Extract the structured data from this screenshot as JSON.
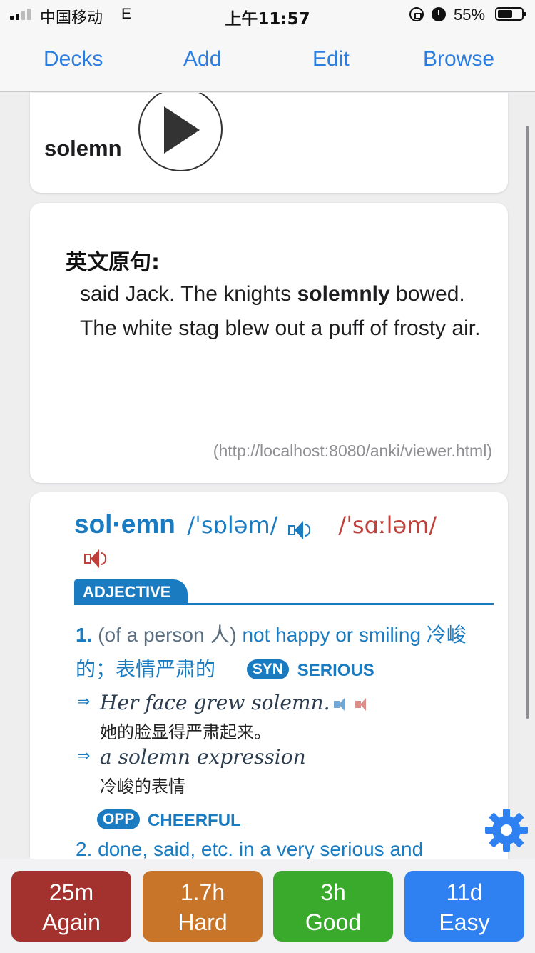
{
  "status_bar": {
    "carrier": "中国移动",
    "network": "E",
    "time": "上午11:57",
    "battery": "55%"
  },
  "nav": {
    "decks": "Decks",
    "add": "Add",
    "edit": "Edit",
    "browse": "Browse"
  },
  "front": {
    "word": "solemn"
  },
  "sentence": {
    "heading": "英文原句:",
    "before": "said Jack. The knights ",
    "highlight": "solemnly",
    "after": " bowed. The white stag blew out a puff of frosty air.",
    "source": "(http://localhost:8080/anki/viewer.html)"
  },
  "dictionary": {
    "headword": "sol·emn",
    "ipa_uk": "/ˈsɒləm/",
    "ipa_us": "/ˈsɑːləm/",
    "pos": "ADJECTIVE",
    "sense1": {
      "number": "1.",
      "gloss": "(of a person 人)",
      "definition": "not happy or smiling 冷峻的；表情严肃的",
      "syn_badge": "SYN",
      "syn_word": "SERIOUS"
    },
    "examples": [
      {
        "en": "Her face grew solemn.",
        "zh": "她的脸显得严肃起来。"
      },
      {
        "en": "a solemn expression",
        "zh": "冷峻的表情"
      }
    ],
    "opp_badge": "OPP",
    "opp_word": "CHEERFUL",
    "sense2_partial": "2. done, said, etc. in a very serious and"
  },
  "answers": [
    {
      "interval": "25m",
      "label": "Again",
      "color": "#a3312e"
    },
    {
      "interval": "1.7h",
      "label": "Hard",
      "color": "#c8752a"
    },
    {
      "interval": "3h",
      "label": "Good",
      "color": "#3aaa2c"
    },
    {
      "interval": "11d",
      "label": "Easy",
      "color": "#2f80f0"
    }
  ],
  "icons": {
    "play": "play-icon",
    "settings": "gear-icon",
    "speaker": "speaker-icon"
  },
  "colors": {
    "link_blue": "#2b7ee0",
    "dict_blue": "#1a7bc0",
    "dict_red": "#c0403b"
  }
}
